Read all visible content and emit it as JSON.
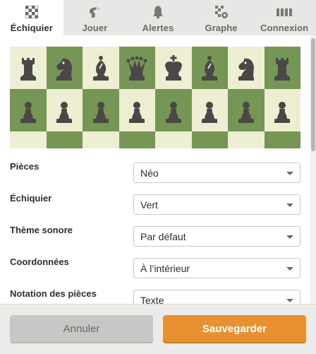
{
  "tabs": [
    {
      "label": "Échiquier",
      "icon": "checkerboard-icon",
      "active": true
    },
    {
      "label": "Jouer",
      "icon": "pawn-hand-icon",
      "active": false
    },
    {
      "label": "Alertes",
      "icon": "bell-icon",
      "active": false
    },
    {
      "label": "Graphe",
      "icon": "board-gear-icon",
      "active": false
    },
    {
      "label": "Connexion",
      "icon": "connection-bars-icon",
      "active": false
    }
  ],
  "board": {
    "light_color": "#eeeed2",
    "dark_color": "#769656",
    "piece_color": "#4a4846",
    "back_rank": [
      "rook",
      "knight",
      "bishop",
      "queen",
      "king",
      "bishop",
      "knight",
      "rook"
    ],
    "pawn_rank": [
      "pawn",
      "pawn",
      "pawn",
      "pawn",
      "pawn",
      "pawn",
      "pawn",
      "pawn"
    ]
  },
  "settings": [
    {
      "label": "Pièces",
      "value": "Néo"
    },
    {
      "label": "Échiquier",
      "value": "Vert"
    },
    {
      "label": "Thème sonore",
      "value": "Par défaut"
    },
    {
      "label": "Coordonnées",
      "value": "À l’intérieur"
    },
    {
      "label": "Notation des pièces",
      "value": "Texte"
    }
  ],
  "footer": {
    "cancel_label": "Annuler",
    "save_label": "Sauvegarder",
    "save_color": "#e79131"
  }
}
